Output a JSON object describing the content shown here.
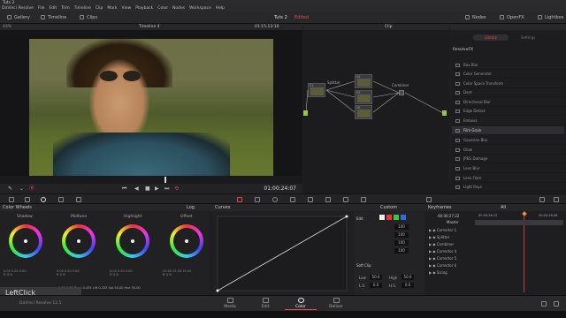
{
  "window": {
    "title": "Tuts 2"
  },
  "menu": [
    "DaVinci Resolve",
    "File",
    "Edit",
    "Trim",
    "Timeline",
    "Clip",
    "Mark",
    "View",
    "Playback",
    "Color",
    "Nodes",
    "Workspace",
    "Help"
  ],
  "toolbar": {
    "gallery": "Gallery",
    "timeline": "Timeline",
    "clips": "Clips",
    "project": "Tuts 2",
    "edited": "Edited",
    "nodes": "Nodes",
    "openfx": "OpenFX",
    "lightbox": "Lightbox"
  },
  "viewer": {
    "zoom": "43%",
    "timeline_name": "Timeline 4",
    "timecode_top": "01:15:13:10",
    "timecode": "01:00:24:07"
  },
  "node_editor": {
    "mode": "Clip",
    "nodes": [
      {
        "num": "01",
        "label": "Splitter"
      },
      {
        "num": "04",
        "label": ""
      },
      {
        "num": "05",
        "label": ""
      },
      {
        "num": "06",
        "label": ""
      },
      {
        "num": "",
        "label": "Combiner"
      }
    ]
  },
  "openfx": {
    "header": "ResolveFX",
    "tabs": [
      "Library",
      "Settings"
    ],
    "items": [
      "Box Blur",
      "Color Generator",
      "Color Space Transform",
      "Dent",
      "Directional Blur",
      "Edge Detect",
      "Emboss",
      "Film Grain",
      "Gaussian Blur",
      "Glow",
      "JPEG Damage",
      "Lens Blur",
      "Lens Flare",
      "Light Rays"
    ],
    "selected": "Film Grain"
  },
  "color_wheels": {
    "title": "Color Wheels",
    "mode": "Log",
    "wheels": [
      {
        "name": "Shadow",
        "values": [
          "0.00",
          "0.00",
          "0.00"
        ],
        "letters": [
          "R",
          "G",
          "B"
        ]
      },
      {
        "name": "Midtone",
        "values": [
          "0.00",
          "0.00",
          "0.00"
        ],
        "letters": [
          "R",
          "G",
          "B"
        ]
      },
      {
        "name": "Highlight",
        "values": [
          "0.00",
          "0.00",
          "0.00"
        ],
        "letters": [
          "R",
          "G",
          "B"
        ]
      },
      {
        "name": "Offset",
        "values": [
          "25.00",
          "25.00",
          "25.00"
        ],
        "letters": [
          "R",
          "G",
          "B"
        ]
      }
    ],
    "footer": [
      {
        "label": "Pivot",
        "value": "0.435"
      },
      {
        "label": "Lift",
        "value": "0.333"
      },
      {
        "label": "Sat",
        "value": "50.00"
      },
      {
        "label": "Hue",
        "value": "50.00"
      },
      {
        "label": "Lum Mix",
        "value": "0.550"
      },
      {
        "label": "Sat",
        "value": "50.00"
      }
    ],
    "footer_leading": [
      "1.00",
      "0.00"
    ]
  },
  "curves": {
    "title": "Curves"
  },
  "edit_panel": {
    "title": "Edit",
    "mode": "Custom",
    "rows": [
      "100",
      "100",
      "100",
      "100"
    ],
    "softclip": "Soft Clip",
    "low": "Low",
    "low_val": "50.0",
    "high": "High",
    "high_val": "50.0",
    "ls": "L.S.",
    "ls_val": "0.0",
    "hs": "H.S.",
    "hs_val": "0.0"
  },
  "keyframes": {
    "title": "Keyframes",
    "filter": "All",
    "timecode": "00:00:27:22",
    "ticks": [
      "00:00:26:12",
      "00:00:28:08"
    ],
    "master": "Master",
    "tracks": [
      "Corrector 1",
      "Splitter",
      "Combiner",
      "Corrector 4",
      "Corrector 5",
      "Corrector 6",
      "Sizing"
    ]
  },
  "pages": [
    {
      "name": "Media",
      "icon": "media-icon"
    },
    {
      "name": "Edit",
      "icon": "edit-icon"
    },
    {
      "name": "Color",
      "icon": "color-icon"
    },
    {
      "name": "Deliver",
      "icon": "deliver-icon"
    }
  ],
  "status": {
    "app": "DaVinci Resolve 12.5"
  },
  "overlay": {
    "leftclick": "LeftClick",
    "sub": "Numb Lock"
  },
  "colors": {
    "accent": "#e64c4c",
    "selected": "#2e2e33"
  }
}
